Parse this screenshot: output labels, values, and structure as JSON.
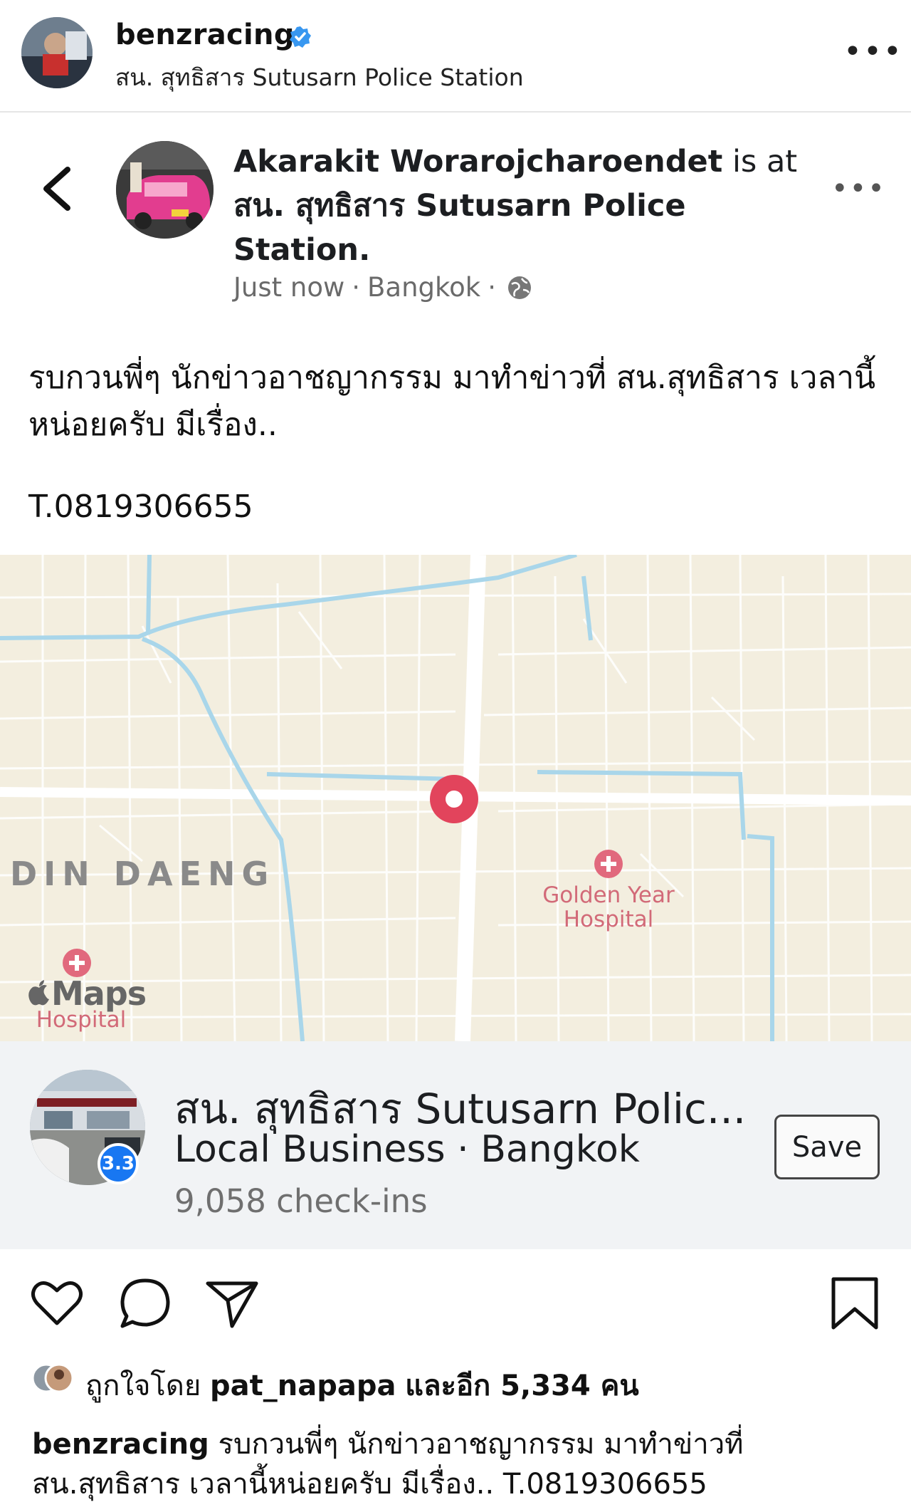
{
  "header": {
    "username": "benzracing",
    "location": "สน. สุทธิสาร Sutusarn Police Station",
    "more_label": "•••"
  },
  "fb_post": {
    "author": "Akarakit Worarojcharoendet",
    "is_at": "is at",
    "place_title": "สน. สุทธิสาร Sutusarn Police Station.",
    "time": "Just now",
    "city": "Bangkok",
    "separator": "·",
    "more_label": "•••",
    "body": "รบกวนพี่ๆ นักข่าวอาชญากรรม มาทำข่าวที่ สน.สุทธิสาร เวลานี้หน่อยครับ มีเรื่อง..",
    "phone": "T.0819306655"
  },
  "map": {
    "district_label": "DIN DAENG",
    "hospital_1": "Golden Year\nHospital",
    "hospital_2": "Hospital",
    "maps_logo": "Maps"
  },
  "place_card": {
    "name": "สน. สุทธิสาร Sutusarn Polic...",
    "category": "Local Business · Bangkok",
    "checkins": "9,058 check-ins",
    "rating": "3.3",
    "save_label": "Save"
  },
  "likes": {
    "prefix": "ถูกใจโดย",
    "user": "pat_napapa",
    "suffix": "และอีก 5,334 คน"
  },
  "caption": {
    "username": "benzracing",
    "text": "รบกวนพี่ๆ นักข่าวอาชญากรรม มาทำข่าวที่ สน.สุทธิสาร เวลานี้หน่อยครับ มีเรื่อง.. T.0819306655"
  },
  "icons": [
    "verified-icon",
    "more-icon",
    "back-chevron-icon",
    "globe-icon",
    "map-pin-icon",
    "hospital-icon",
    "apple-icon",
    "heart-icon",
    "comment-icon",
    "share-icon",
    "bookmark-icon"
  ],
  "colors": {
    "verified": "#3897f0",
    "pin": "#e2445c",
    "water": "#a9d6ea",
    "map_bg": "#f3eedf",
    "fb_blue": "#1877f2"
  }
}
